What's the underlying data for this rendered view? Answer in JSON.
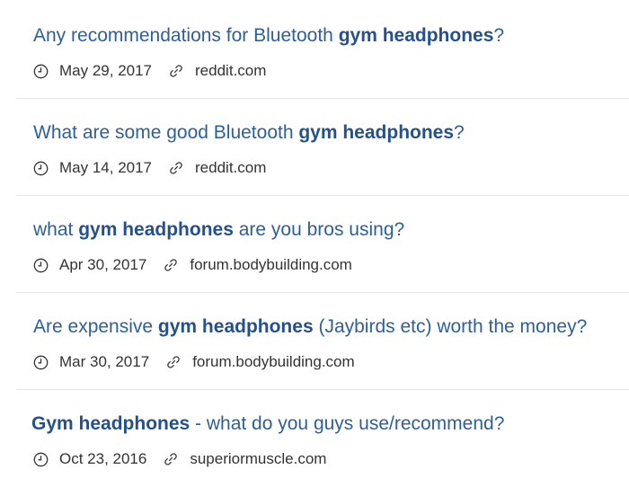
{
  "results": [
    {
      "title_pre": "Any recommendations for Bluetooth ",
      "title_hl": "gym headphones",
      "title_post": "?",
      "date": "May 29, 2017",
      "source": "reddit.com",
      "icons": [
        "clock-icon",
        "link-icon"
      ]
    },
    {
      "title_pre": "What are some good Bluetooth ",
      "title_hl": "gym headphones",
      "title_post": "?",
      "date": "May 14, 2017",
      "source": "reddit.com",
      "icons": [
        "clock-icon",
        "link-icon"
      ]
    },
    {
      "title_pre": "what ",
      "title_hl": "gym headphones",
      "title_post": " are you bros using?",
      "date": "Apr 30, 2017",
      "source": "forum.bodybuilding.com",
      "icons": [
        "clock-icon",
        "link-icon"
      ]
    },
    {
      "title_pre": "Are expensive ",
      "title_hl": "gym headphones",
      "title_post": " (Jaybirds etc) worth the money?",
      "date": "Mar 30, 2017",
      "source": "forum.bodybuilding.com",
      "icons": [
        "clock-icon",
        "link-icon"
      ]
    },
    {
      "title_pre": "",
      "title_hl": "Gym headphones",
      "title_post": " - what do you guys use/recommend?",
      "date": "Oct 23, 2016",
      "source": "superiormuscle.com",
      "icons": [
        "clock-icon",
        "link-icon"
      ]
    }
  ],
  "colors": {
    "title": "#2d5f99",
    "highlight": "#24518a",
    "meta_text": "#333333",
    "divider": "#e6e6e6"
  }
}
